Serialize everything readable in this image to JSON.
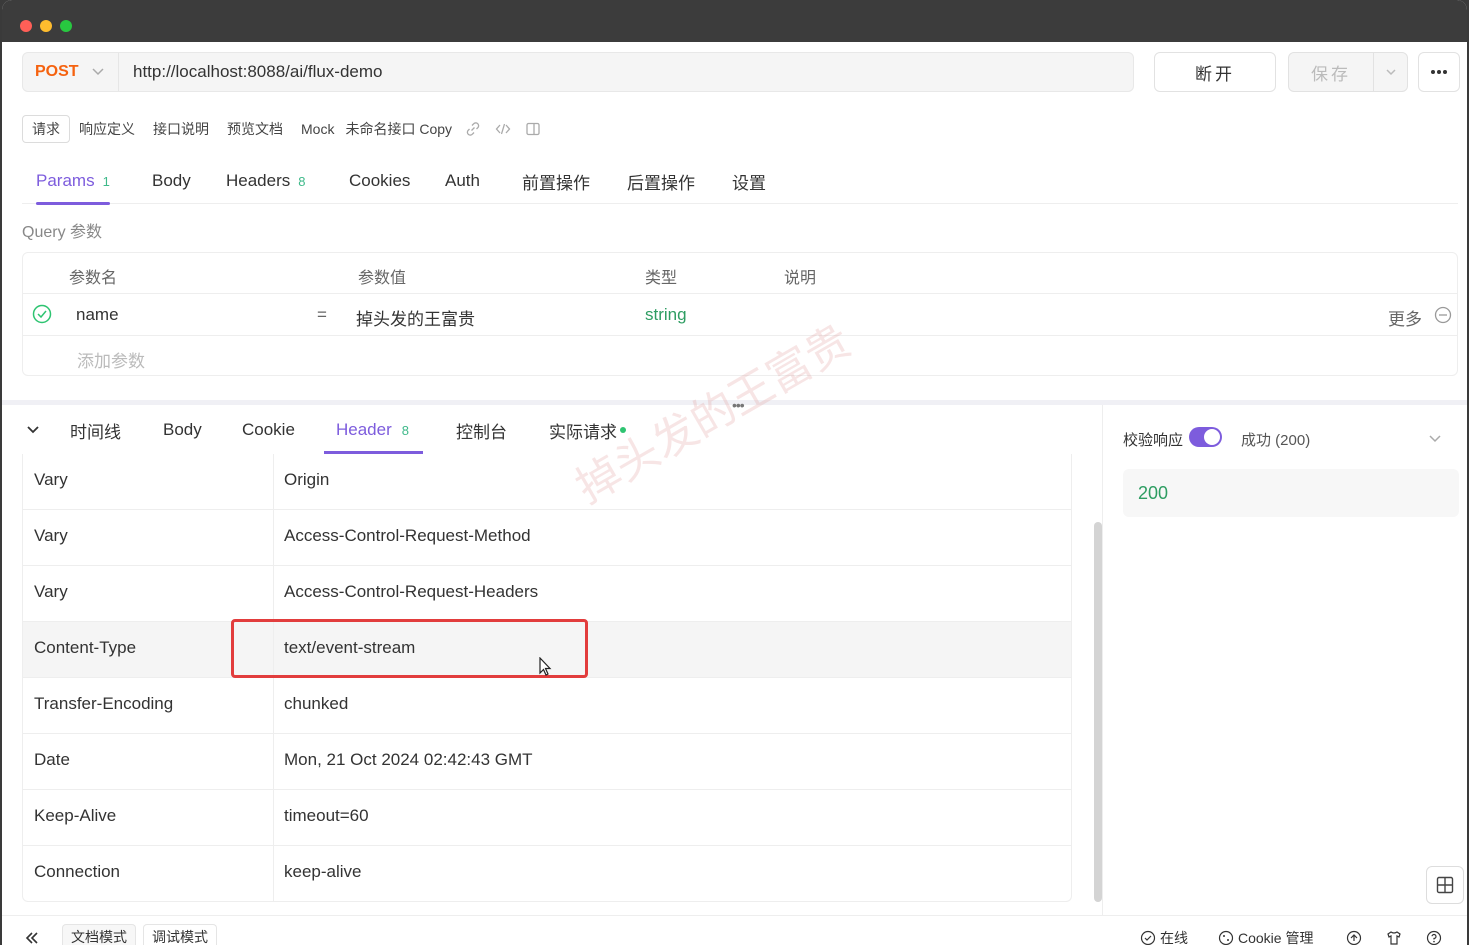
{
  "request": {
    "method": "POST",
    "url": "http://localhost:8088/ai/flux-demo",
    "disconnect_label": "断开",
    "save_label": "保存"
  },
  "subtabs": {
    "items": [
      "请求",
      "响应定义",
      "接口说明",
      "预览文档",
      "Mock"
    ],
    "api_name": "未命名接口 Copy"
  },
  "param_tabs": [
    {
      "label": "Params",
      "count": "1"
    },
    {
      "label": "Body",
      "count": ""
    },
    {
      "label": "Headers",
      "count": "8"
    },
    {
      "label": "Cookies",
      "count": ""
    },
    {
      "label": "Auth",
      "count": ""
    },
    {
      "label": "前置操作",
      "count": ""
    },
    {
      "label": "后置操作",
      "count": ""
    },
    {
      "label": "设置",
      "count": ""
    }
  ],
  "query": {
    "section_title": "Query 参数",
    "headers": {
      "name": "参数名",
      "value": "参数值",
      "type": "类型",
      "desc": "说明"
    },
    "rows": [
      {
        "name": "name",
        "eq": "=",
        "value": "掉头发的王富贵",
        "type": "string",
        "more": "更多"
      }
    ],
    "add_placeholder": "添加参数"
  },
  "response_tabs": [
    {
      "label": "时间线",
      "count": ""
    },
    {
      "label": "Body",
      "count": ""
    },
    {
      "label": "Cookie",
      "count": ""
    },
    {
      "label": "Header",
      "count": "8"
    },
    {
      "label": "控制台",
      "count": ""
    },
    {
      "label": "实际请求",
      "count": ""
    }
  ],
  "response_headers": [
    {
      "key": "Vary",
      "value": "Origin"
    },
    {
      "key": "Vary",
      "value": "Access-Control-Request-Method"
    },
    {
      "key": "Vary",
      "value": "Access-Control-Request-Headers"
    },
    {
      "key": "Content-Type",
      "value": "text/event-stream"
    },
    {
      "key": "Transfer-Encoding",
      "value": "chunked"
    },
    {
      "key": "Date",
      "value": "Mon, 21 Oct 2024 02:42:43 GMT"
    },
    {
      "key": "Keep-Alive",
      "value": "timeout=60"
    },
    {
      "key": "Connection",
      "value": "keep-alive"
    }
  ],
  "validation": {
    "label": "校验响应",
    "enabled": true,
    "status": "成功 (200)",
    "code": "200"
  },
  "watermark": "掉头发的王富贵",
  "footer": {
    "doc_mode": "文档模式",
    "debug_mode": "调试模式",
    "online": "在线",
    "cookie_manage": "Cookie 管理"
  },
  "colors": {
    "accent": "#7d5cdd",
    "method": "#f5620f",
    "success": "#2e9d62",
    "highlight_box": "#e23d3d"
  }
}
